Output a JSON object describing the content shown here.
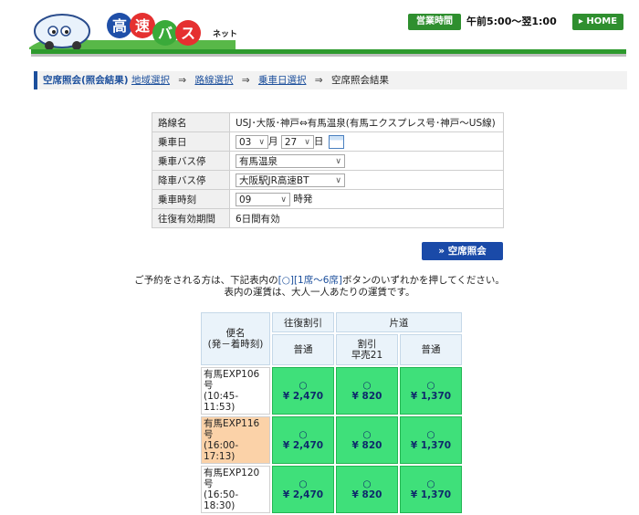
{
  "header": {
    "logo_text": "高速バスネット",
    "hours_label": "営業時間",
    "hours_text": "午前5:00〜翌1:00",
    "home_label": "▸ HOME",
    "colors": {
      "green": "#2e9a2e",
      "blue": "#1c4f9c"
    }
  },
  "breadcrumb": {
    "current": "空席照会(照会結果)",
    "links": [
      "地域選択",
      "路線選択",
      "乗車日選択"
    ],
    "last": "空席照会結果",
    "arrow": "⇒"
  },
  "form": {
    "route_label": "路線名",
    "route_value": "USJ･大阪･神戸⇔有馬温泉(有馬エクスプレス号･神戸〜US線)",
    "date_label": "乗車日",
    "month": "03",
    "month_unit": "月",
    "day": "27",
    "day_unit": "日",
    "board_label": "乗車バス停",
    "board_value": "有馬温泉",
    "alight_label": "降車バス停",
    "alight_value": "大阪駅JR高速BT",
    "time_label": "乗車時刻",
    "time_value": "09",
    "time_unit": "時発",
    "validity_label": "往復有効期間",
    "validity_value": "6日間有効"
  },
  "search_button": "» 空席照会",
  "notice": {
    "line1_pre": "ご予約をされる方は、下記表内の",
    "line1_blue": "[○][1席〜6席]",
    "line1_post": "ボタンのいずれかを押してください。",
    "line2": "表内の運賃は、大人一人あたりの運賃です。"
  },
  "fares": {
    "col_service": "便名",
    "col_service_sub": "(発－着時刻)",
    "col_roundtrip": "往復割引",
    "col_oneway": "片道",
    "col_normal": "普通",
    "col_discount": "割引",
    "col_discount_sub": "早売21",
    "col_normal2": "普通",
    "rows": [
      {
        "name": "有馬EXP106号",
        "time": "(10:45-11:53)",
        "a_mark": "○",
        "a": "¥ 2,470",
        "b_mark": "○",
        "b": "¥ 820",
        "c_mark": "○",
        "c": "¥ 1,370"
      },
      {
        "name": "有馬EXP116号",
        "time": "(16:00-17:13)",
        "a_mark": "○",
        "a": "¥ 2,470",
        "b_mark": "○",
        "b": "¥ 820",
        "c_mark": "○",
        "c": "¥ 1,370"
      },
      {
        "name": "有馬EXP120号",
        "time": "(16:50-18:30)",
        "a_mark": "○",
        "a": "¥ 2,470",
        "b_mark": "○",
        "b": "¥ 820",
        "c_mark": "○",
        "c": "¥ 1,370"
      }
    ]
  }
}
